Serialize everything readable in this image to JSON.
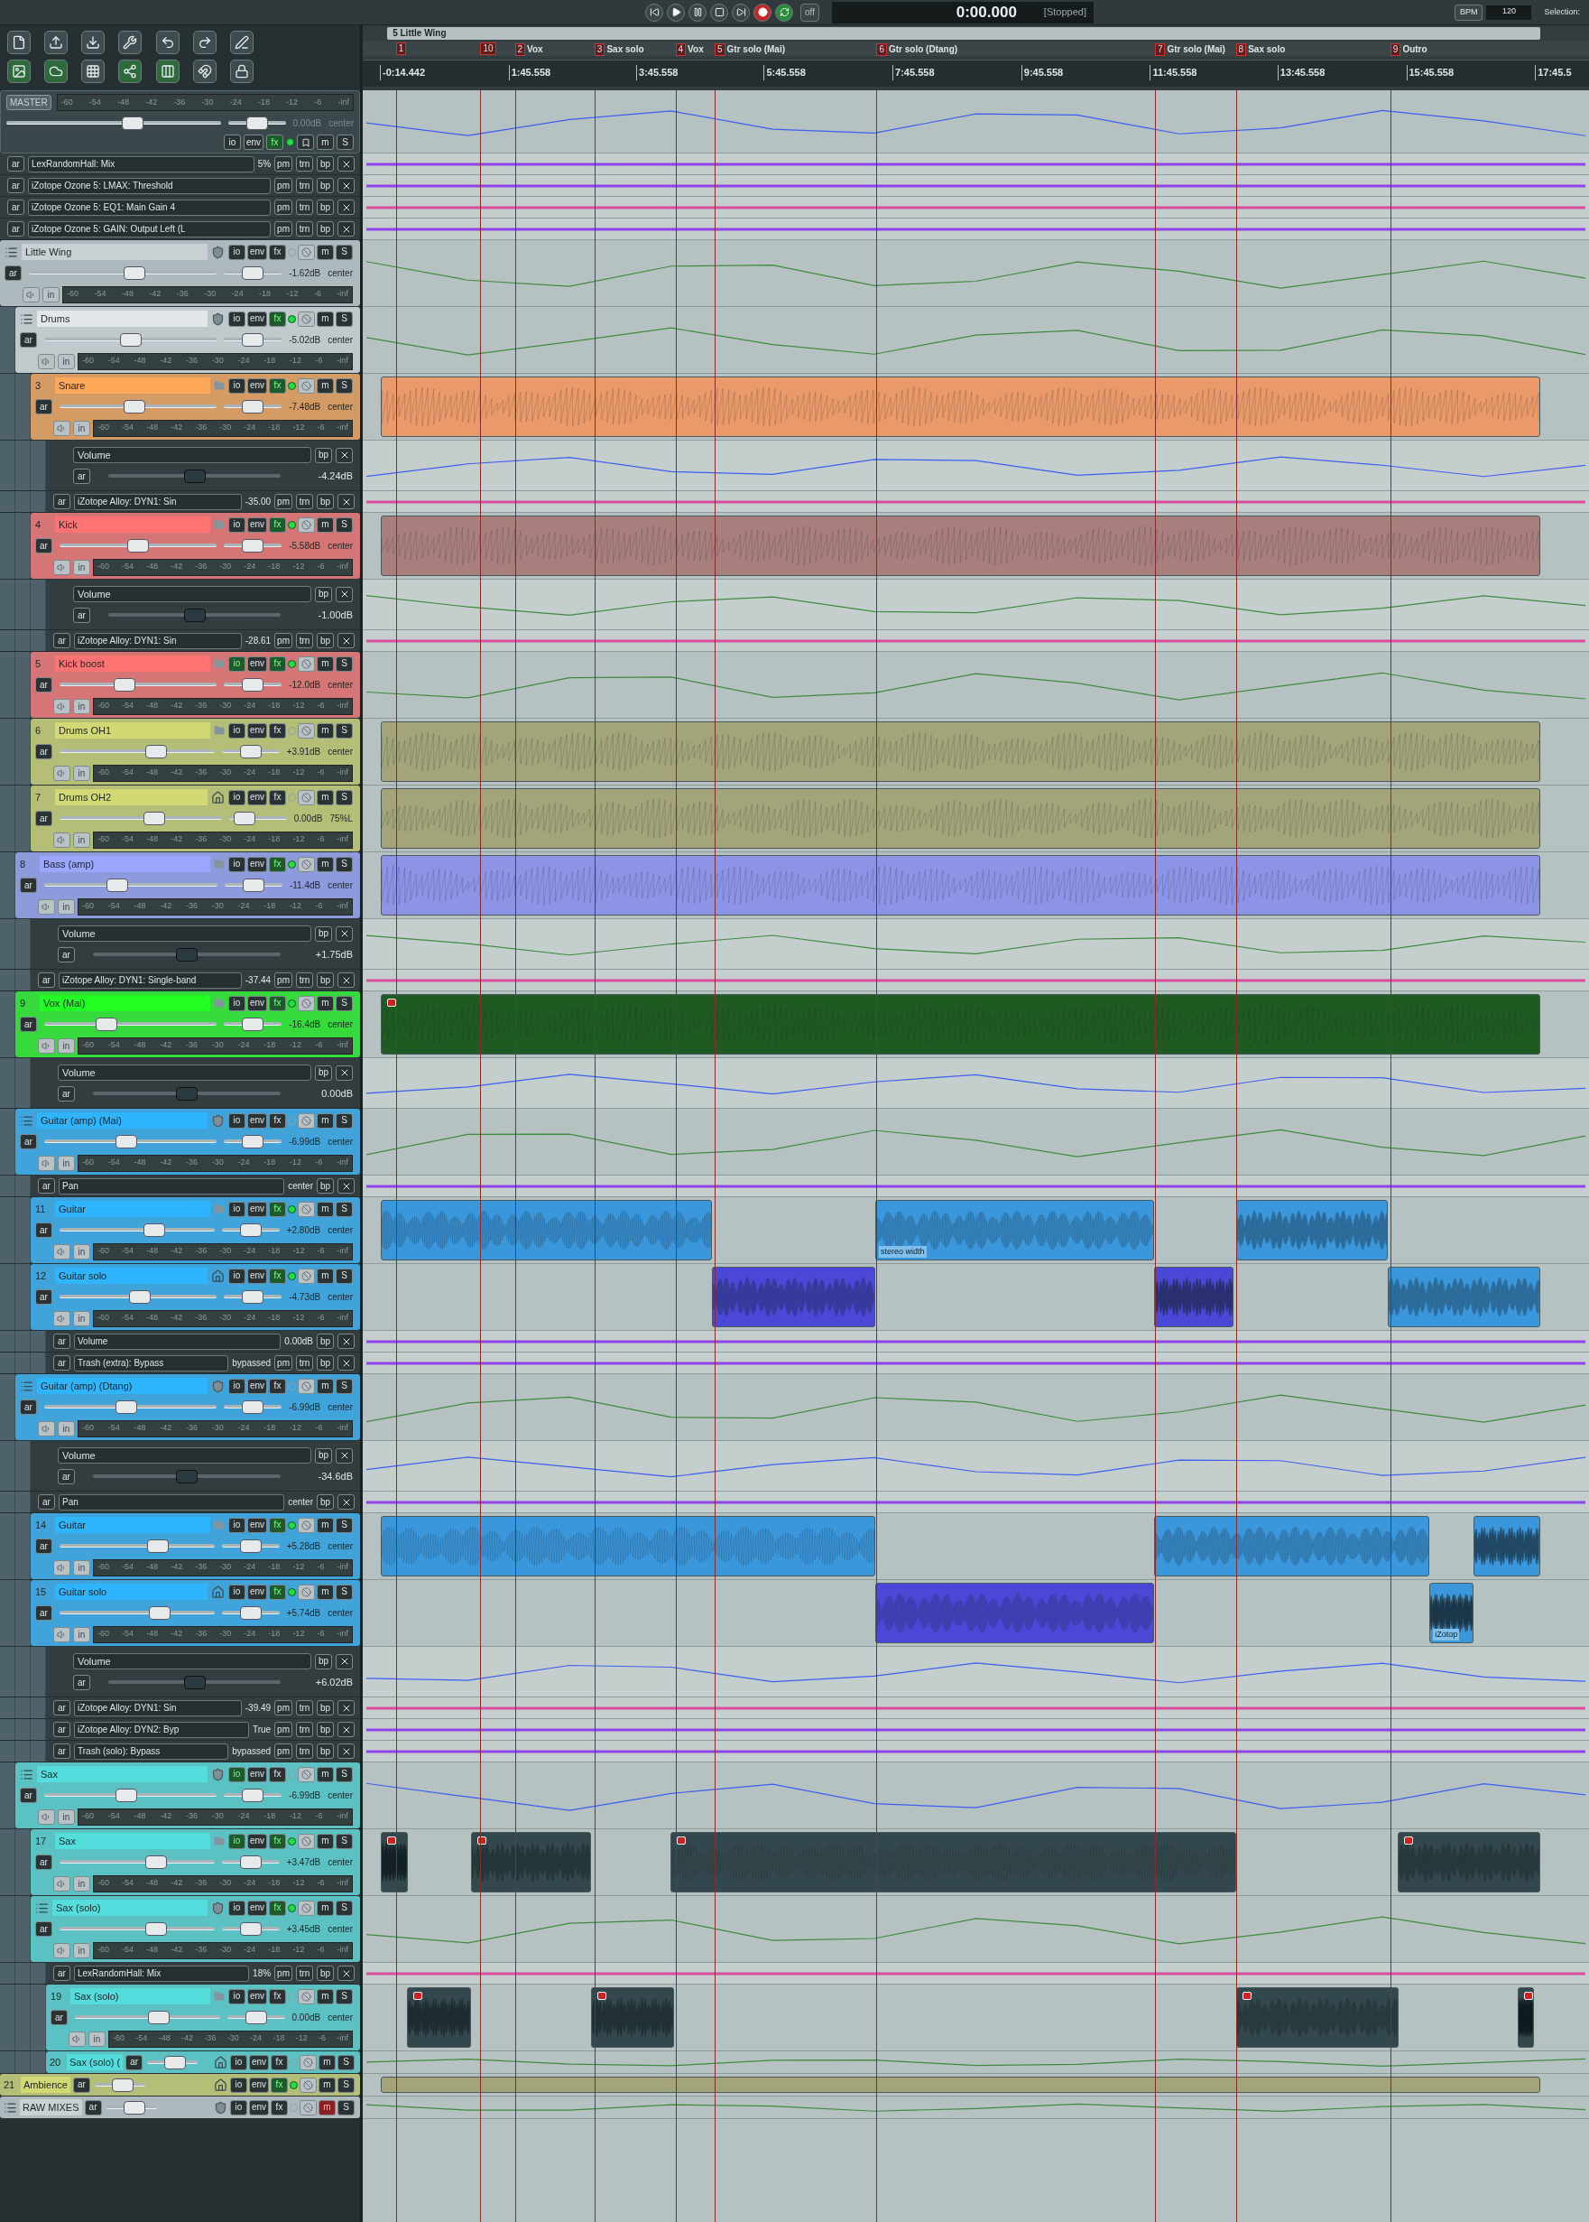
{
  "transport": {
    "buttons": [
      {
        "kind": "start"
      },
      {
        "kind": "play"
      },
      {
        "kind": "pause"
      },
      {
        "kind": "stop"
      },
      {
        "kind": "end"
      },
      {
        "kind": "record"
      },
      {
        "kind": "repeat"
      }
    ],
    "off_label": "off",
    "time": "0:00.000",
    "status": "[Stopped]",
    "bpm_label": "BPM",
    "bpm": "120",
    "selection_label": "Selection:"
  },
  "toolbar": [
    {
      "on": false
    },
    {
      "on": false
    },
    {
      "on": false
    },
    {
      "on": false
    },
    {
      "on": false
    },
    {
      "on": false
    },
    {
      "on": false
    },
    {
      "on": true
    },
    {
      "on": true
    },
    {
      "on": false
    },
    {
      "on": true
    },
    {
      "on": true
    },
    {
      "on": false
    },
    {
      "on": false
    }
  ],
  "timeline": {
    "region": "5 Little Wing",
    "markers": [
      {
        "number": "1"
      },
      {
        "number": "10"
      },
      {
        "number": "2",
        "name": "Vox"
      },
      {
        "number": "3",
        "name": "Sax solo"
      },
      {
        "number": "4",
        "name": "Vox"
      },
      {
        "number": "5",
        "name": "Gtr solo (Mai)"
      },
      {
        "number": "6",
        "name": "Gtr solo (Dtang)"
      },
      {
        "number": "7",
        "name": "Gtr solo (Mai)"
      },
      {
        "number": "8",
        "name": "Sax solo"
      },
      {
        "number": "9",
        "name": "Outro"
      }
    ],
    "ruler": [
      "-0:14.442",
      "1:45.558",
      "3:45.558",
      "5:45.558",
      "7:45.558",
      "9:45.558",
      "11:45.558",
      "13:45.558",
      "15:45.558",
      "17:45.5"
    ]
  },
  "master": {
    "label": "MASTER",
    "meter_scale": [
      "-60",
      "-54",
      "-48",
      "-42",
      "-36",
      "-30",
      "-24",
      "-18",
      "-12",
      "-6",
      "-inf"
    ],
    "level": 0.6,
    "volume": "0.00dB",
    "pan": {
      "reading": "center",
      "level": 0.5
    },
    "buttons": [
      {
        "label": "io",
        "on": false
      },
      {
        "label": "env",
        "on": false
      },
      {
        "label": "fx",
        "on": true
      },
      {
        "label": "m",
        "on": false
      },
      {
        "label": "S",
        "on": false
      }
    ],
    "led_on": true,
    "lanes": [
      {
        "kind": "param",
        "arm": "ar",
        "name": "LexRandomHall: Mix",
        "value": "5%",
        "buttons": [
          "pm",
          "trn",
          "bp"
        ]
      },
      {
        "kind": "param",
        "arm": "ar",
        "name": "iZotope Ozone 5: LMAX: Threshold",
        "buttons": [
          "pm",
          "trn",
          "bp"
        ]
      },
      {
        "kind": "param",
        "arm": "ar",
        "name": "iZotope Ozone 5: EQ1: Main Gain 4",
        "buttons": [
          "pm",
          "trn",
          "bp"
        ]
      },
      {
        "kind": "param",
        "arm": "ar",
        "name": "iZotope Ozone 5: GAIN: Output Left (L",
        "buttons": [
          "pm",
          "trn",
          "bp"
        ]
      }
    ]
  },
  "tracks": [
    {
      "kind": "full",
      "name": "Little Wing",
      "color": "#c9d1d5",
      "folder_parent": true,
      "folder_end": false,
      "arm": "ar",
      "input": "in",
      "level": 0.57,
      "volume": "-1.62dB",
      "pan": {
        "reading": "center",
        "level": 0.5
      },
      "led_on": false,
      "buttons": [
        {
          "label": "io",
          "on": false
        },
        {
          "label": "env",
          "on": false
        },
        {
          "label": "fx",
          "on": false
        },
        {
          "label": "m",
          "on": false
        },
        {
          "label": "S",
          "on": false
        }
      ],
      "meter_scale": [
        "-60",
        "-54",
        "-48",
        "-42",
        "-36",
        "-30",
        "-24",
        "-18",
        "-12",
        "-6",
        "-inf"
      ],
      "children": [
        {
          "kind": "full",
          "name": "Drums",
          "color": "#e2e8ea",
          "folder_parent": true,
          "folder_end": false,
          "arm": "ar",
          "input": "in",
          "level": 0.5,
          "volume": "-5.02dB",
          "pan": {
            "reading": "center",
            "level": 0.5
          },
          "led_on": true,
          "buttons": [
            {
              "label": "io",
              "on": false
            },
            {
              "label": "env",
              "on": false
            },
            {
              "label": "fx",
              "on": true
            },
            {
              "label": "m",
              "on": false
            },
            {
              "label": "S",
              "on": false
            }
          ],
          "meter_scale": [
            "-60",
            "-54",
            "-48",
            "-42",
            "-36",
            "-30",
            "-24",
            "-18",
            "-12",
            "-6",
            "-inf"
          ],
          "children": [
            {
              "kind": "full",
              "number": "3",
              "name": "Snare",
              "color": "#ffa85a",
              "folder_parent": false,
              "folder_end": false,
              "arm": "ar",
              "input": "in",
              "level": 0.47,
              "volume": "-7.48dB",
              "pan": {
                "reading": "center",
                "level": 0.5
              },
              "led_on": true,
              "buttons": [
                {
                  "label": "io",
                  "on": false
                },
                {
                  "label": "env",
                  "on": false
                },
                {
                  "label": "fx",
                  "on": true
                },
                {
                  "label": "m",
                  "on": false
                },
                {
                  "label": "S",
                  "on": false
                }
              ],
              "meter_scale": [
                "-60",
                "-54",
                "-48",
                "-42",
                "-36",
                "-30",
                "-24",
                "-18",
                "-12",
                "-6",
                "-inf"
              ],
              "lanes": [
                {
                  "kind": "envelope",
                  "arm": "ar",
                  "name": "Volume",
                  "value": "-4.24dB",
                  "level": 0.5,
                  "buttons": [
                    "bp"
                  ]
                },
                {
                  "kind": "param",
                  "arm": "ar",
                  "name": "iZotope Alloy: DYN1: Sin",
                  "value": "-35.00",
                  "buttons": [
                    "pm",
                    "trn",
                    "bp"
                  ]
                }
              ]
            },
            {
              "kind": "full",
              "number": "4",
              "name": "Kick",
              "color": "#ff7373",
              "folder_parent": false,
              "folder_end": false,
              "arm": "ar",
              "input": "in",
              "level": 0.5,
              "volume": "-5.58dB",
              "pan": {
                "reading": "center",
                "level": 0.5
              },
              "led_on": true,
              "buttons": [
                {
                  "label": "io",
                  "on": false
                },
                {
                  "label": "env",
                  "on": false
                },
                {
                  "label": "fx",
                  "on": true
                },
                {
                  "label": "m",
                  "on": false
                },
                {
                  "label": "S",
                  "on": false
                }
              ],
              "meter_scale": [
                "-60",
                "-54",
                "-48",
                "-42",
                "-36",
                "-30",
                "-24",
                "-18",
                "-12",
                "-6",
                "-inf"
              ],
              "lanes": [
                {
                  "kind": "envelope",
                  "arm": "ar",
                  "name": "Volume",
                  "value": "-1.00dB",
                  "level": 0.5,
                  "buttons": [
                    "bp"
                  ]
                },
                {
                  "kind": "param",
                  "arm": "ar",
                  "name": "iZotope Alloy: DYN1: Sin",
                  "value": "-28.61",
                  "buttons": [
                    "pm",
                    "trn",
                    "bp"
                  ]
                }
              ]
            },
            {
              "kind": "full",
              "number": "5",
              "name": "Kick boost",
              "color": "#ff7373",
              "folder_parent": false,
              "folder_end": false,
              "arm": "ar",
              "input": "in",
              "level": 0.4,
              "volume": "-12.0dB",
              "pan": {
                "reading": "center",
                "level": 0.5
              },
              "led_on": true,
              "buttons": [
                {
                  "label": "io",
                  "on": true
                },
                {
                  "label": "env",
                  "on": false
                },
                {
                  "label": "fx",
                  "on": true
                },
                {
                  "label": "m",
                  "on": false
                },
                {
                  "label": "S",
                  "on": false
                }
              ],
              "meter_scale": [
                "-60",
                "-54",
                "-48",
                "-42",
                "-36",
                "-30",
                "-24",
                "-18",
                "-12",
                "-6",
                "-inf"
              ]
            },
            {
              "kind": "full",
              "number": "6",
              "name": "Drums OH1",
              "color": "#d2d874",
              "folder_parent": false,
              "folder_end": false,
              "arm": "ar",
              "input": "in",
              "level": 0.64,
              "volume": "+3.91dB",
              "pan": {
                "reading": "center",
                "level": 0.5
              },
              "led_on": false,
              "buttons": [
                {
                  "label": "io",
                  "on": false
                },
                {
                  "label": "env",
                  "on": false
                },
                {
                  "label": "fx",
                  "on": false
                },
                {
                  "label": "m",
                  "on": false
                },
                {
                  "label": "S",
                  "on": false
                }
              ],
              "meter_scale": [
                "-60",
                "-54",
                "-48",
                "-42",
                "-36",
                "-30",
                "-24",
                "-18",
                "-12",
                "-6",
                "-inf"
              ]
            },
            {
              "kind": "full",
              "number": "7",
              "name": "Drums OH2",
              "color": "#d2d874",
              "folder_parent": false,
              "folder_end": true,
              "arm": "ar",
              "input": "in",
              "level": 0.6,
              "volume": "0.00dB",
              "pan": {
                "reading": "75%L",
                "level": 0.13
              },
              "led_on": false,
              "buttons": [
                {
                  "label": "io",
                  "on": false
                },
                {
                  "label": "env",
                  "on": false
                },
                {
                  "label": "fx",
                  "on": false
                },
                {
                  "label": "m",
                  "on": false
                },
                {
                  "label": "S",
                  "on": false
                }
              ],
              "meter_scale": [
                "-60",
                "-54",
                "-48",
                "-42",
                "-36",
                "-30",
                "-24",
                "-18",
                "-12",
                "-6",
                "-inf"
              ]
            }
          ]
        },
        {
          "kind": "full",
          "number": "8",
          "name": "Bass (amp)",
          "color": "#9aa6ff",
          "folder_parent": false,
          "folder_end": false,
          "arm": "ar",
          "input": "in",
          "level": 0.41,
          "volume": "-11.4dB",
          "pan": {
            "reading": "center",
            "level": 0.5
          },
          "led_on": true,
          "buttons": [
            {
              "label": "io",
              "on": false
            },
            {
              "label": "env",
              "on": false
            },
            {
              "label": "fx",
              "on": true
            },
            {
              "label": "m",
              "on": false
            },
            {
              "label": "S",
              "on": false
            }
          ],
          "meter_scale": [
            "-60",
            "-54",
            "-48",
            "-42",
            "-36",
            "-30",
            "-24",
            "-18",
            "-12",
            "-6",
            "-inf"
          ],
          "lanes": [
            {
              "kind": "envelope",
              "arm": "ar",
              "name": "Volume",
              "value": "+1.75dB",
              "level": 0.5,
              "buttons": [
                "bp"
              ]
            },
            {
              "kind": "param",
              "arm": "ar",
              "name": "iZotope Alloy: DYN1: Single-band",
              "value": "-37.44",
              "buttons": [
                "pm",
                "trn",
                "bp"
              ]
            }
          ]
        },
        {
          "kind": "full",
          "number": "9",
          "name": "Vox (Mai)",
          "color": "#22ff22",
          "folder_parent": false,
          "folder_end": false,
          "arm": "ar",
          "input": "in",
          "level": 0.34,
          "volume": "-16.4dB",
          "pan": {
            "reading": "center",
            "level": 0.5
          },
          "led_on": true,
          "buttons": [
            {
              "label": "io",
              "on": false
            },
            {
              "label": "env",
              "on": false
            },
            {
              "label": "fx",
              "on": true
            },
            {
              "label": "m",
              "on": false
            },
            {
              "label": "S",
              "on": false
            }
          ],
          "meter_scale": [
            "-60",
            "-54",
            "-48",
            "-42",
            "-36",
            "-30",
            "-24",
            "-18",
            "-12",
            "-6",
            "-inf"
          ],
          "lanes": [
            {
              "kind": "envelope",
              "arm": "ar",
              "name": "Volume",
              "value": "0.00dB",
              "level": 0.5,
              "buttons": [
                "bp"
              ]
            }
          ]
        },
        {
          "kind": "full",
          "name": "Guitar (amp) (Mai)",
          "color": "#2fb5ff",
          "folder_parent": true,
          "folder_end": false,
          "arm": "ar",
          "input": "in",
          "level": 0.47,
          "volume": "-6.99dB",
          "pan": {
            "reading": "center",
            "level": 0.5
          },
          "led_on": false,
          "buttons": [
            {
              "label": "io",
              "on": false
            },
            {
              "label": "env",
              "on": false
            },
            {
              "label": "fx",
              "on": false
            },
            {
              "label": "m",
              "on": false
            },
            {
              "label": "S",
              "on": false
            }
          ],
          "meter_scale": [
            "-60",
            "-54",
            "-48",
            "-42",
            "-36",
            "-30",
            "-24",
            "-18",
            "-12",
            "-6",
            "-inf"
          ],
          "lanes": [
            {
              "kind": "param",
              "arm": "ar",
              "name": "Pan",
              "value": "center",
              "buttons": [
                "bp"
              ]
            }
          ],
          "children": [
            {
              "kind": "full",
              "number": "11",
              "name": "Guitar",
              "color": "#2fb5ff",
              "folder_parent": false,
              "folder_end": false,
              "arm": "ar",
              "input": "in",
              "level": 0.63,
              "volume": "+2.80dB",
              "pan": {
                "reading": "center",
                "level": 0.5
              },
              "led_on": true,
              "buttons": [
                {
                  "label": "io",
                  "on": false
                },
                {
                  "label": "env",
                  "on": false
                },
                {
                  "label": "fx",
                  "on": true
                },
                {
                  "label": "m",
                  "on": false
                },
                {
                  "label": "S",
                  "on": false
                }
              ],
              "meter_scale": [
                "-60",
                "-54",
                "-48",
                "-42",
                "-36",
                "-30",
                "-24",
                "-18",
                "-12",
                "-6",
                "-inf"
              ],
              "item_labels": [
                "stereo width"
              ]
            },
            {
              "kind": "full",
              "number": "12",
              "name": "Guitar solo",
              "color": "#2fb5ff",
              "folder_parent": false,
              "folder_end": true,
              "arm": "ar",
              "input": "in",
              "level": 0.51,
              "volume": "-4.73dB",
              "pan": {
                "reading": "center",
                "level": 0.5
              },
              "led_on": true,
              "buttons": [
                {
                  "label": "io",
                  "on": false
                },
                {
                  "label": "env",
                  "on": false
                },
                {
                  "label": "fx",
                  "on": true
                },
                {
                  "label": "m",
                  "on": false
                },
                {
                  "label": "S",
                  "on": false
                }
              ],
              "meter_scale": [
                "-60",
                "-54",
                "-48",
                "-42",
                "-36",
                "-30",
                "-24",
                "-18",
                "-12",
                "-6",
                "-inf"
              ],
              "lanes": [
                {
                  "kind": "param",
                  "arm": "ar",
                  "name": "Volume",
                  "value": "0.00dB",
                  "buttons": [
                    "bp"
                  ]
                },
                {
                  "kind": "param",
                  "arm": "ar",
                  "name": "Trash (extra): Bypass",
                  "value": "bypassed",
                  "buttons": [
                    "pm",
                    "trn",
                    "bp"
                  ]
                }
              ]
            }
          ]
        },
        {
          "kind": "full",
          "name": "Guitar (amp) (Dtang)",
          "color": "#2fb5ff",
          "folder_parent": true,
          "folder_end": false,
          "arm": "ar",
          "input": "in",
          "level": 0.47,
          "volume": "-6.99dB",
          "pan": {
            "reading": "center",
            "level": 0.5
          },
          "led_on": false,
          "buttons": [
            {
              "label": "io",
              "on": false
            },
            {
              "label": "env",
              "on": false
            },
            {
              "label": "fx",
              "on": false
            },
            {
              "label": "m",
              "on": false
            },
            {
              "label": "S",
              "on": false
            }
          ],
          "meter_scale": [
            "-60",
            "-54",
            "-48",
            "-42",
            "-36",
            "-30",
            "-24",
            "-18",
            "-12",
            "-6",
            "-inf"
          ],
          "lanes": [
            {
              "kind": "envelope",
              "arm": "ar",
              "name": "Volume",
              "value": "-34.6dB",
              "level": 0.5,
              "buttons": [
                "bp"
              ]
            },
            {
              "kind": "param",
              "arm": "ar",
              "name": "Pan",
              "value": "center",
              "buttons": [
                "bp"
              ]
            }
          ],
          "children": [
            {
              "kind": "full",
              "number": "14",
              "name": "Guitar",
              "color": "#2fb5ff",
              "folder_parent": false,
              "folder_end": false,
              "arm": "ar",
              "input": "in",
              "level": 0.66,
              "volume": "+5.28dB",
              "pan": {
                "reading": "center",
                "level": 0.5
              },
              "led_on": true,
              "buttons": [
                {
                  "label": "io",
                  "on": false
                },
                {
                  "label": "env",
                  "on": false
                },
                {
                  "label": "fx",
                  "on": true
                },
                {
                  "label": "m",
                  "on": false
                },
                {
                  "label": "S",
                  "on": false
                }
              ],
              "meter_scale": [
                "-60",
                "-54",
                "-48",
                "-42",
                "-36",
                "-30",
                "-24",
                "-18",
                "-12",
                "-6",
                "-inf"
              ]
            },
            {
              "kind": "full",
              "number": "15",
              "name": "Guitar solo",
              "color": "#2fb5ff",
              "folder_parent": false,
              "folder_end": true,
              "arm": "ar",
              "input": "in",
              "level": 0.67,
              "volume": "+5.74dB",
              "pan": {
                "reading": "center",
                "level": 0.5
              },
              "led_on": true,
              "buttons": [
                {
                  "label": "io",
                  "on": false
                },
                {
                  "label": "env",
                  "on": false
                },
                {
                  "label": "fx",
                  "on": true
                },
                {
                  "label": "m",
                  "on": false
                },
                {
                  "label": "S",
                  "on": false
                }
              ],
              "meter_scale": [
                "-60",
                "-54",
                "-48",
                "-42",
                "-36",
                "-30",
                "-24",
                "-18",
                "-12",
                "-6",
                "-inf"
              ],
              "item_labels": [
                "iZotop"
              ],
              "lanes": [
                {
                  "kind": "envelope",
                  "arm": "ar",
                  "name": "Volume",
                  "value": "+6.02dB",
                  "level": 0.5,
                  "buttons": [
                    "bp"
                  ]
                },
                {
                  "kind": "param",
                  "arm": "ar",
                  "name": "iZotope Alloy: DYN1: Sin",
                  "value": "-39.49",
                  "buttons": [
                    "pm",
                    "trn",
                    "bp"
                  ]
                },
                {
                  "kind": "param",
                  "arm": "ar",
                  "name": "iZotope Alloy: DYN2: Byp",
                  "value": "True",
                  "buttons": [
                    "pm",
                    "trn",
                    "bp"
                  ]
                },
                {
                  "kind": "param",
                  "arm": "ar",
                  "name": "Trash (solo): Bypass",
                  "value": "bypassed",
                  "buttons": [
                    "pm",
                    "trn",
                    "bp"
                  ]
                }
              ]
            }
          ]
        },
        {
          "kind": "full",
          "name": "Sax",
          "color": "#55dcdc",
          "folder_parent": true,
          "folder_end": false,
          "arm": "ar",
          "input": "in",
          "level": 0.47,
          "volume": "-6.99dB",
          "pan": {
            "reading": "center",
            "level": 0.5
          },
          "led_on": false,
          "buttons": [
            {
              "label": "io",
              "on": true
            },
            {
              "label": "env",
              "on": false
            },
            {
              "label": "fx",
              "on": false
            },
            {
              "label": "m",
              "on": false
            },
            {
              "label": "S",
              "on": false
            }
          ],
          "meter_scale": [
            "-60",
            "-54",
            "-48",
            "-42",
            "-36",
            "-30",
            "-24",
            "-18",
            "-12",
            "-6",
            "-inf"
          ],
          "children": [
            {
              "kind": "full",
              "number": "17",
              "name": "Sax",
              "color": "#55dcdc",
              "folder_parent": false,
              "folder_end": false,
              "arm": "ar",
              "input": "in",
              "level": 0.64,
              "volume": "+3.47dB",
              "pan": {
                "reading": "center",
                "level": 0.5
              },
              "led_on": true,
              "buttons": [
                {
                  "label": "io",
                  "on": true
                },
                {
                  "label": "env",
                  "on": false
                },
                {
                  "label": "fx",
                  "on": true
                },
                {
                  "label": "m",
                  "on": false
                },
                {
                  "label": "S",
                  "on": false
                }
              ],
              "meter_scale": [
                "-60",
                "-54",
                "-48",
                "-42",
                "-36",
                "-30",
                "-24",
                "-18",
                "-12",
                "-6",
                "-inf"
              ]
            },
            {
              "kind": "full",
              "name": "Sax (solo)",
              "color": "#55dcdc",
              "folder_parent": true,
              "folder_end": false,
              "arm": "ar",
              "input": "in",
              "level": 0.64,
              "volume": "+3.45dB",
              "pan": {
                "reading": "center",
                "level": 0.5
              },
              "led_on": true,
              "buttons": [
                {
                  "label": "io",
                  "on": false
                },
                {
                  "label": "env",
                  "on": false
                },
                {
                  "label": "fx",
                  "on": true
                },
                {
                  "label": "m",
                  "on": false
                },
                {
                  "label": "S",
                  "on": false
                }
              ],
              "meter_scale": [
                "-60",
                "-54",
                "-48",
                "-42",
                "-36",
                "-30",
                "-24",
                "-18",
                "-12",
                "-6",
                "-inf"
              ],
              "lanes": [
                {
                  "kind": "param",
                  "arm": "ar",
                  "name": "LexRandomHall: Mix",
                  "value": "18%",
                  "buttons": [
                    "pm",
                    "trn",
                    "bp"
                  ]
                }
              ],
              "children": [
                {
                  "kind": "full",
                  "number": "19",
                  "name": "Sax (solo)",
                  "color": "#55dcdc",
                  "folder_parent": false,
                  "folder_end": false,
                  "arm": "ar",
                  "input": "in",
                  "level": 0.59,
                  "volume": "0.00dB",
                  "pan": {
                    "reading": "center",
                    "level": 0.5
                  },
                  "led_on": false,
                  "buttons": [
                    {
                      "label": "io",
                      "on": false
                    },
                    {
                      "label": "env",
                      "on": false
                    },
                    {
                      "label": "fx",
                      "on": false
                    },
                    {
                      "label": "m",
                      "on": false
                    },
                    {
                      "label": "S",
                      "on": false
                    }
                  ],
                  "meter_scale": [
                    "-60",
                    "-54",
                    "-48",
                    "-42",
                    "-36",
                    "-30",
                    "-24",
                    "-18",
                    "-12",
                    "-6",
                    "-inf"
                  ]
                },
                {
                  "kind": "compact",
                  "number": "20",
                  "name": "Sax (solo) (",
                  "color": "#55dcdc",
                  "folder_parent": false,
                  "folder_end": true,
                  "arm": "ar",
                  "level": 0.6,
                  "led_on": false,
                  "buttons": [
                    {
                      "label": "io",
                      "on": false
                    },
                    {
                      "label": "env",
                      "on": false
                    },
                    {
                      "label": "fx",
                      "on": false
                    },
                    {
                      "label": "m",
                      "on": false
                    },
                    {
                      "label": "S",
                      "on": false
                    }
                  ]
                }
              ]
            }
          ]
        }
      ]
    },
    {
      "kind": "compact",
      "number": "21",
      "name": "Ambience",
      "color": "#d2d874",
      "folder_parent": false,
      "folder_end": true,
      "arm": "ar",
      "level": 0.6,
      "led_on": true,
      "buttons": [
        {
          "label": "io",
          "on": false
        },
        {
          "label": "env",
          "on": false
        },
        {
          "label": "fx",
          "on": true
        },
        {
          "label": "m",
          "on": false
        },
        {
          "label": "S",
          "on": false
        }
      ]
    },
    {
      "kind": "compact",
      "name": "RAW MIXES",
      "color": "#c9d1d5",
      "folder_parent": true,
      "folder_end": false,
      "arm": "ar",
      "level": 0.6,
      "led_on": false,
      "buttons": [
        {
          "label": "io",
          "on": false
        },
        {
          "label": "env",
          "on": false
        },
        {
          "label": "fx",
          "on": false
        },
        {
          "label": "m",
          "on": true
        },
        {
          "label": "S",
          "on": false
        }
      ]
    }
  ]
}
